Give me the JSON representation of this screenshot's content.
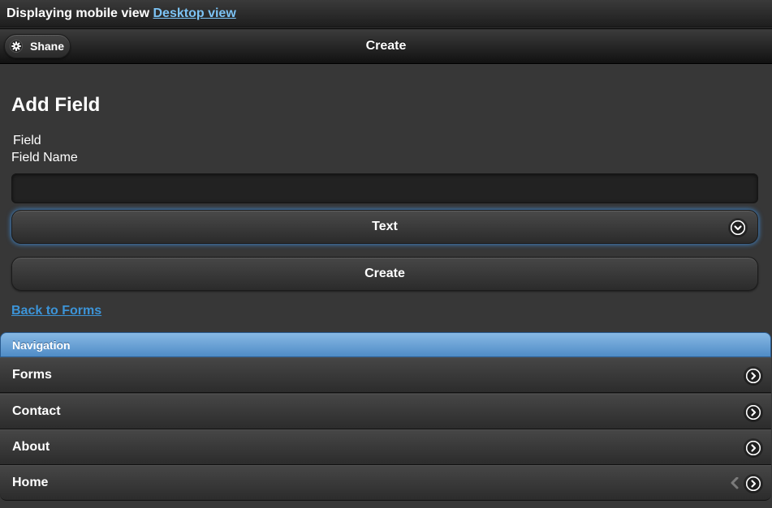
{
  "top_bar": {
    "text": "Displaying mobile view",
    "link": "Desktop view"
  },
  "header": {
    "title": "Create",
    "user_button": "Shane",
    "user_icon": "gear-icon"
  },
  "form": {
    "heading": "Add Field",
    "field_label": "Field",
    "field_name_label": "Field Name",
    "field_name_value": "",
    "field_name_placeholder": "",
    "type_select": "Text",
    "type_select_icon": "chevron-down-icon",
    "submit_label": "Create",
    "back_link": "Back to Forms"
  },
  "navigation": {
    "title": "Navigation",
    "item_icon": "chevron-right-icon",
    "items": [
      {
        "label": "Forms"
      },
      {
        "label": "Contact"
      },
      {
        "label": "About"
      },
      {
        "label": "Home"
      }
    ]
  },
  "colors": {
    "page_background": "#373737",
    "link": "#3c94d8",
    "top_link": "#7cc3f5",
    "nav_divider": "#5f9cd4",
    "focus_glow": "#3f7fbf"
  }
}
